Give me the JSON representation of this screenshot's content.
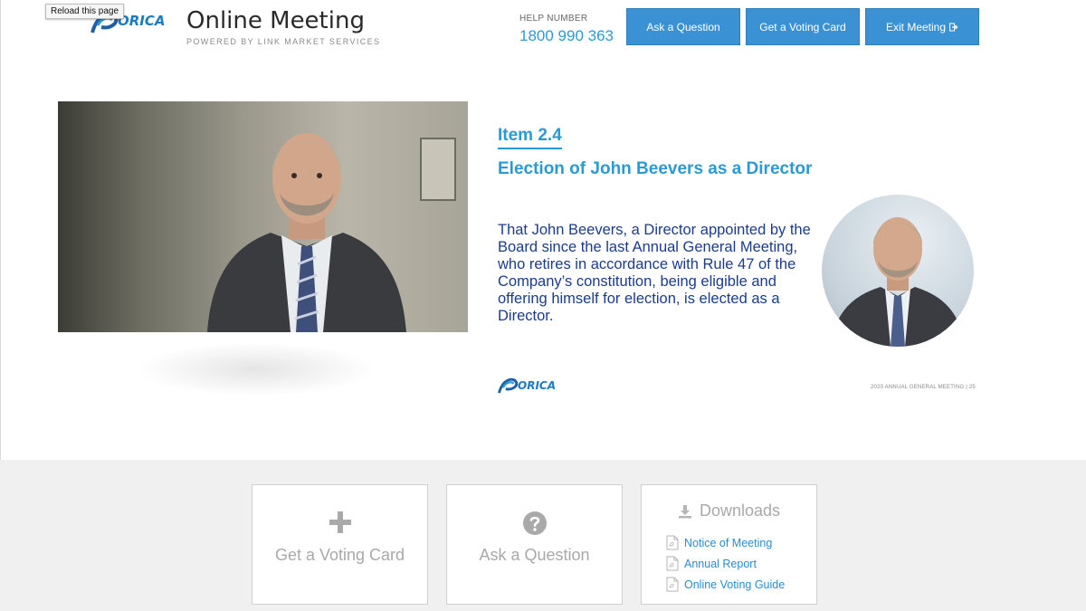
{
  "browser": {
    "tooltip": "Reload this page"
  },
  "header": {
    "logo_text": "ORICA",
    "title": "Online Meeting",
    "subtitle": "POWERED BY LINK MARKET SERVICES",
    "help_label": "HELP NUMBER",
    "help_number": "1800 990 363",
    "buttons": {
      "ask": "Ask a Question",
      "vote": "Get a Voting Card",
      "exit": "Exit Meeting"
    }
  },
  "slide": {
    "item": "Item 2.4",
    "heading": "Election of John Beevers as a Director",
    "body": "That John Beevers, a Director appointed by the Board since the last Annual General Meeting, who retires in accordance with Rule 47 of the Company’s constitution, being eligible and offering himself for election, is elected as a Director.",
    "logo_text": "ORICA",
    "footer": "2020 ANNUAL GENERAL MEETING   |   25"
  },
  "cards": {
    "vote_label": "Get a Voting Card",
    "ask_label": "Ask a Question",
    "downloads_title": "Downloads",
    "downloads": [
      {
        "label": "Notice of Meeting"
      },
      {
        "label": "Annual Report"
      },
      {
        "label": "Online Voting Guide"
      }
    ]
  },
  "colors": {
    "accent": "#3a92d5",
    "link": "#2a8ccd",
    "slide_blue": "#2b9ad4",
    "body_blue": "#1a3c8c"
  }
}
